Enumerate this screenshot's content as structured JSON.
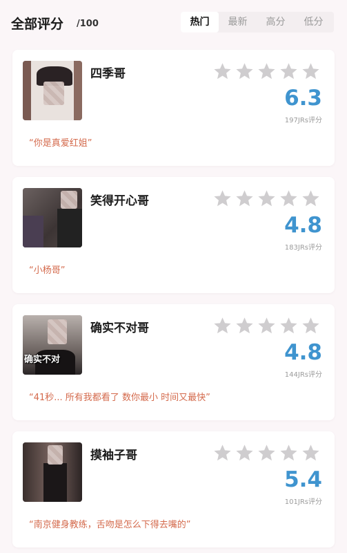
{
  "header": {
    "title": "全部评分",
    "title_suffix": "/100",
    "tabs": [
      {
        "label": "热门",
        "active": true
      },
      {
        "label": "最新",
        "active": false
      },
      {
        "label": "高分",
        "active": false
      },
      {
        "label": "低分",
        "active": false
      }
    ]
  },
  "star_color": "#cfcdcf",
  "score_color": "#3f94cf",
  "quote_color": "#d46a4c",
  "cards": [
    {
      "name": "四季哥",
      "score": "6.3",
      "ratings": "197JRs评分",
      "quote": "“你是真爱红姐”",
      "avatar_caption": ""
    },
    {
      "name": "笑得开心哥",
      "score": "4.8",
      "ratings": "183JRs评分",
      "quote": "“小杨哥”",
      "avatar_caption": ""
    },
    {
      "name": "确实不对哥",
      "score": "4.8",
      "ratings": "144JRs评分",
      "quote": "“41秒... 所有我都看了 数你最小 时间又最快”",
      "avatar_caption": "确实不对"
    },
    {
      "name": "摸袖子哥",
      "score": "5.4",
      "ratings": "101JRs评分",
      "quote": "“南京健身教练，舌吻是怎么下得去嘴的”",
      "avatar_caption": ""
    }
  ]
}
